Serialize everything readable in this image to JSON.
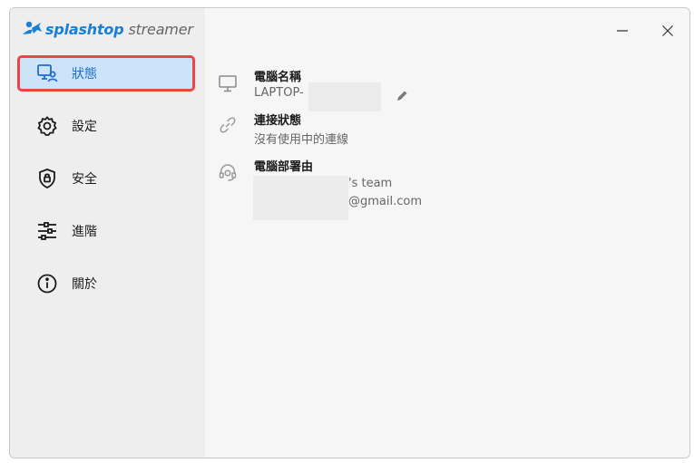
{
  "app": {
    "brand": "splashtop",
    "product": "streamer",
    "accent_color": "#1a7fd6"
  },
  "window_controls": {
    "minimize_icon": "minimize-icon",
    "close_icon": "close-icon"
  },
  "sidebar": {
    "items": [
      {
        "label": "狀態",
        "icon": "monitor-status-icon",
        "active": true
      },
      {
        "label": "設定",
        "icon": "gear-icon",
        "active": false
      },
      {
        "label": "安全",
        "icon": "shield-lock-icon",
        "active": false
      },
      {
        "label": "進階",
        "icon": "sliders-icon",
        "active": false
      },
      {
        "label": "關於",
        "icon": "info-icon",
        "active": false
      }
    ]
  },
  "status": {
    "computer_name": {
      "title": "電腦名稱",
      "value": "LAPTOP-",
      "icon": "monitor-icon",
      "edit_icon": "pencil-icon"
    },
    "connection": {
      "title": "連接狀態",
      "value": "沒有使用中的連線",
      "icon": "link-icon"
    },
    "deployed_by": {
      "title": "電腦部署由",
      "line1": "'s team",
      "line2": "@gmail.com",
      "icon": "headset-icon"
    }
  }
}
